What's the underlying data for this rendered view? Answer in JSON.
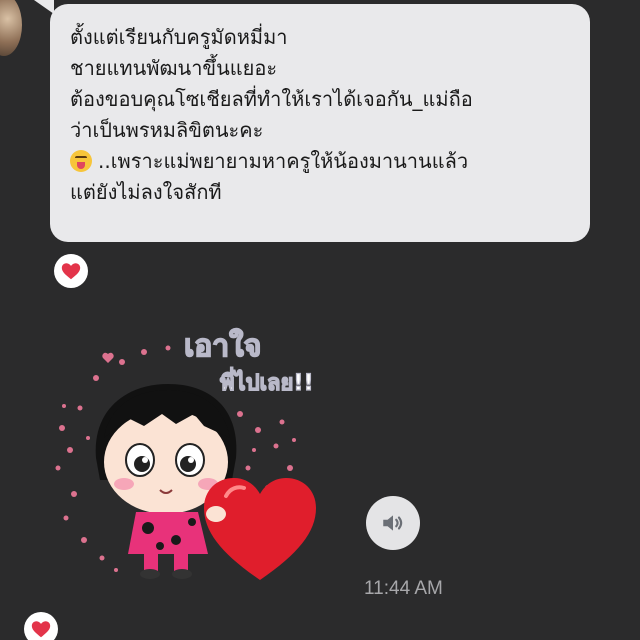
{
  "message": {
    "lines": [
      "ตั้งแต่เรียนกับครูมัดหมี่มา",
      "ชายแทนพัฒนาขึ้นแยอะ",
      "ต้องขอบคุณโซเชียลที่ทำให้เราได้เจอกัน_แม่ถือ",
      "ว่าเป็นพรหมลิขิตนะคะ",
      "..เพราะแม่พยายามหาครูให้น้องมานานแล้ว",
      "แต่ยังไม่ลงใจสักที"
    ],
    "emoji_icon": "squinting-tongue-emoji"
  },
  "sticker": {
    "caption_line1": "เอาใจ",
    "caption_line2": "พี่ไปเลย!!"
  },
  "audio": {
    "icon": "speaker-icon"
  },
  "timestamp": "11:44 AM",
  "reaction": {
    "icon": "heart-icon",
    "color": "#e3344a"
  },
  "colors": {
    "background": "#2b2b2c",
    "bubble": "#e9e9eb",
    "timestamp": "#a7a7aa"
  }
}
